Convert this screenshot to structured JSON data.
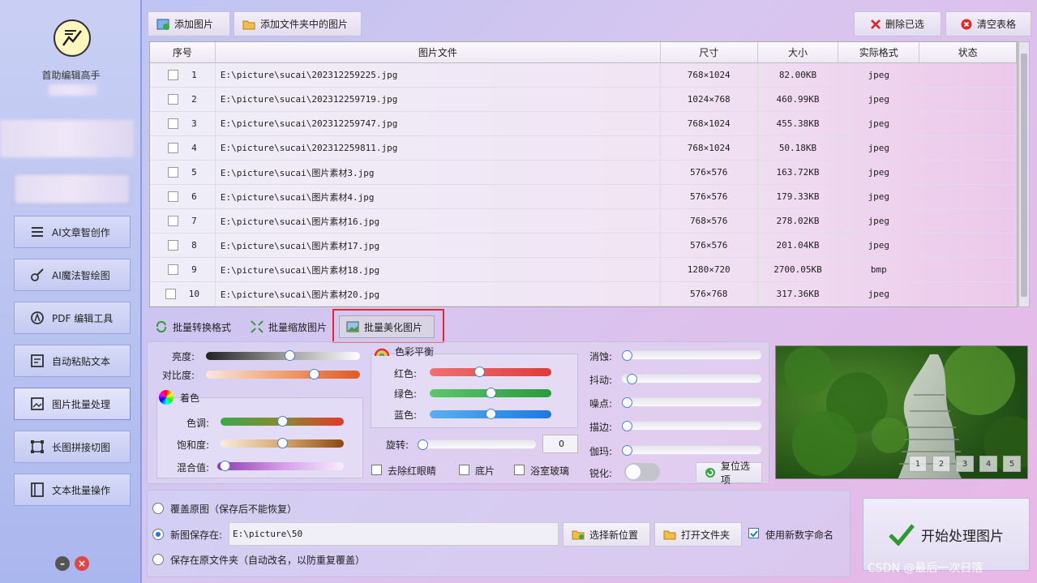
{
  "sidebar": {
    "app_name": "首助编辑高手",
    "nav": [
      {
        "label": "AI文章智创作",
        "icon": "list-icon"
      },
      {
        "label": "AI魔法智绘图",
        "icon": "brush-icon"
      },
      {
        "label": "PDF 编辑工具",
        "icon": "pdf-icon"
      },
      {
        "label": "自动粘贴文本",
        "icon": "paste-icon"
      },
      {
        "label": "图片批量处理",
        "icon": "image-icon"
      },
      {
        "label": "长图拼接切图",
        "icon": "crop-icon"
      },
      {
        "label": "文本批量操作",
        "icon": "book-icon"
      }
    ]
  },
  "toolbar": {
    "add_image": "添加图片",
    "add_folder": "添加文件夹中的图片",
    "delete_selected": "删除已选",
    "clear_table": "清空表格"
  },
  "table": {
    "headers": [
      "序号",
      "图片文件",
      "尺寸",
      "大小",
      "实际格式",
      "状态"
    ],
    "rows": [
      {
        "n": "1",
        "file": "E:\\picture\\sucai\\202312259225.jpg",
        "size": "768×1024",
        "bytes": "82.00KB",
        "fmt": "jpeg",
        "status": ""
      },
      {
        "n": "2",
        "file": "E:\\picture\\sucai\\202312259719.jpg",
        "size": "1024×768",
        "bytes": "460.99KB",
        "fmt": "jpeg",
        "status": ""
      },
      {
        "n": "3",
        "file": "E:\\picture\\sucai\\202312259747.jpg",
        "size": "768×1024",
        "bytes": "455.38KB",
        "fmt": "jpeg",
        "status": ""
      },
      {
        "n": "4",
        "file": "E:\\picture\\sucai\\202312259811.jpg",
        "size": "768×1024",
        "bytes": "50.18KB",
        "fmt": "jpeg",
        "status": ""
      },
      {
        "n": "5",
        "file": "E:\\picture\\sucai\\图片素材3.jpg",
        "size": "576×576",
        "bytes": "163.72KB",
        "fmt": "jpeg",
        "status": ""
      },
      {
        "n": "6",
        "file": "E:\\picture\\sucai\\图片素材4.jpg",
        "size": "576×576",
        "bytes": "179.33KB",
        "fmt": "jpeg",
        "status": ""
      },
      {
        "n": "7",
        "file": "E:\\picture\\sucai\\图片素材16.jpg",
        "size": "768×576",
        "bytes": "278.02KB",
        "fmt": "jpeg",
        "status": ""
      },
      {
        "n": "8",
        "file": "E:\\picture\\sucai\\图片素材17.jpg",
        "size": "576×576",
        "bytes": "201.04KB",
        "fmt": "jpeg",
        "status": ""
      },
      {
        "n": "9",
        "file": "E:\\picture\\sucai\\图片素材18.jpg",
        "size": "1280×720",
        "bytes": "2700.05KB",
        "fmt": "bmp",
        "status": ""
      },
      {
        "n": "10",
        "file": "E:\\picture\\sucai\\图片素材20.jpg",
        "size": "576×768",
        "bytes": "317.36KB",
        "fmt": "jpeg",
        "status": ""
      }
    ]
  },
  "tabs": [
    {
      "label": "批量转换格式"
    },
    {
      "label": "批量缩放图片"
    },
    {
      "label": "批量美化图片"
    }
  ],
  "adjust": {
    "brightness": "亮度:",
    "contrast": "对比度:",
    "tint_group": "着色",
    "hue": "色调:",
    "saturation": "饱和度:",
    "blend": "混合值:",
    "color_balance": "色彩平衡",
    "red": "红色:",
    "green": "绿色:",
    "blue": "蓝色:",
    "rotate": "旋转:",
    "rotate_value": "0",
    "redeye": "去除红眼睛",
    "negative": "底片",
    "bath_glass": "浴室玻璃",
    "erode": "消蚀:",
    "shake": "抖动:",
    "noise": "噪点:",
    "edge": "描边:",
    "mosaic": "伽玛:",
    "sharpen": "锐化:",
    "reset": "复位选项",
    "levels": {
      "brightness": 0.55,
      "contrast": 0.72,
      "hue": 0.5,
      "saturation": 0.5,
      "blend": 0.02,
      "red": 0.4,
      "green": 0.5,
      "blue": 0.5,
      "rotate": 0.0
    }
  },
  "preview": {
    "pages": [
      "1",
      "2",
      "3",
      "4",
      "5"
    ]
  },
  "output": {
    "overwrite": "覆盖原图（保存后不能恢复）",
    "save_new": "新图保存在:",
    "save_path": "E:\\picture\\50",
    "choose_location": "选择新位置",
    "open_folder": "打开文件夹",
    "use_numbers": "使用新数字命名",
    "save_original": "保存在原文件夹（自动改名，以防重复覆盖）",
    "start": "开始处理图片"
  },
  "watermark": "CSDN @最后一次日落"
}
